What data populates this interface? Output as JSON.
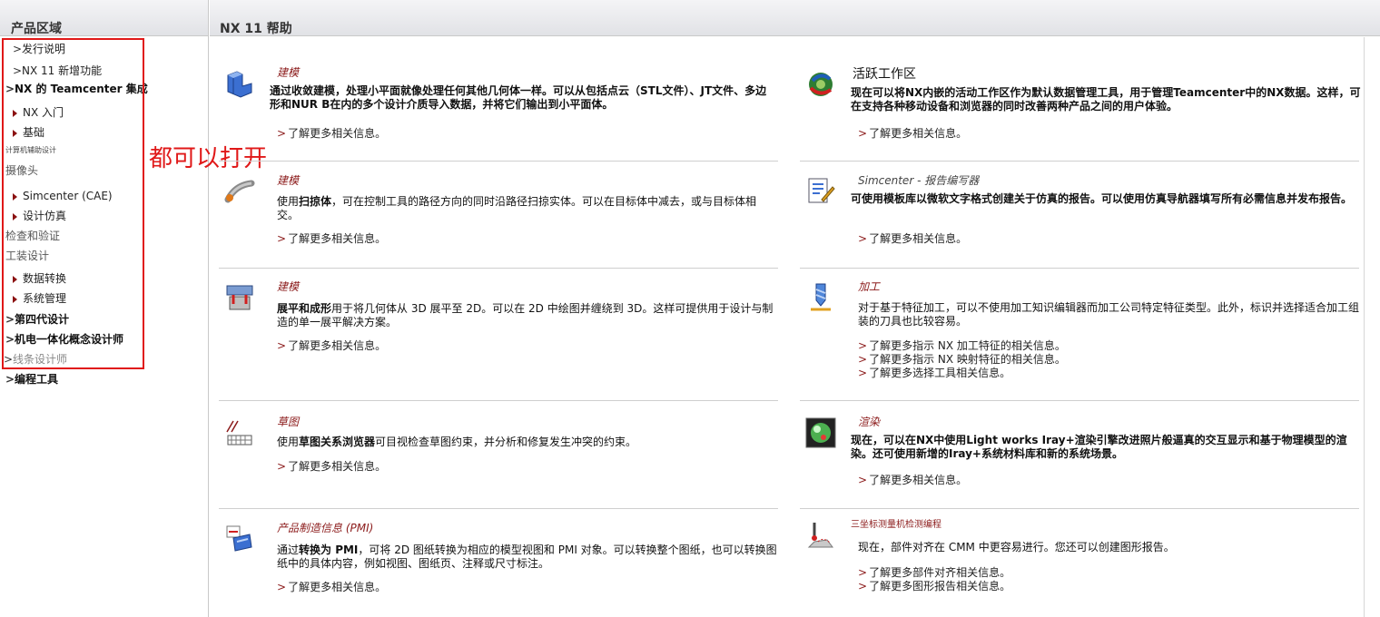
{
  "sidebar": {
    "header": "产品区域",
    "items": [
      {
        "label": "发行说明",
        "style": "lvl2",
        "marker": ">"
      },
      {
        "label": "NX 11 新增功能",
        "style": "lvl2",
        "marker": ">"
      },
      {
        "label": "NX 的 Teamcenter 集成",
        "style": "lvl1",
        "marker": ">"
      },
      {
        "label": "NX 入门",
        "style": "lvl2",
        "marker": "tri"
      },
      {
        "label": "基础",
        "style": "lvl2",
        "marker": "tri"
      },
      {
        "label": "计算机辅助设计",
        "style": "small",
        "marker": ""
      },
      {
        "label": "摄像头",
        "style": "cat",
        "marker": ""
      },
      {
        "label": "Simcenter (CAE)",
        "style": "lvl2",
        "marker": "tri"
      },
      {
        "label": "设计仿真",
        "style": "lvl2",
        "marker": "tri"
      },
      {
        "label": "检查和验证",
        "style": "cat",
        "marker": ""
      },
      {
        "label": "工装设计",
        "style": "cat",
        "marker": ""
      },
      {
        "label": "数据转换",
        "style": "lvl2",
        "marker": "tri"
      },
      {
        "label": "系统管理",
        "style": "lvl2",
        "marker": "tri"
      },
      {
        "label": "第四代设计",
        "style": "lvl1",
        "marker": ">"
      },
      {
        "label": "机电一体化概念设计师",
        "style": "lvl1",
        "marker": ">"
      },
      {
        "label": "线条设计师",
        "style": "muted",
        "marker": ">"
      },
      {
        "label": "编程工具",
        "style": "lvl1",
        "marker": ">"
      }
    ]
  },
  "annotation": "都可以打开",
  "main": {
    "header": "NX 11 帮助",
    "cards": [
      {
        "title": "建模",
        "icon": "modeling-block-icon",
        "desc": "通过收敛建模，处理小平面就像处理任何其他几何体一样。可以从包括点云（STL文件）、JT文件、多边形和NUR B在内的多个设计介质导入数据，并将它们输出到小平面体。",
        "desc_bold": true,
        "links": [
          "了解更多相关信息。"
        ]
      },
      {
        "title": "建模",
        "icon": "sweep-icon",
        "desc_parts": [
          "使用",
          "扫掠体",
          "，可在控制工具的路径方向的同时沿路径扫掠实体。可以在目标体中减去，或与目标体相交。"
        ],
        "links": [
          "了解更多相关信息。"
        ]
      },
      {
        "title": "建模",
        "icon": "flatten-form-icon",
        "desc_parts": [
          "",
          "展平和成形",
          "用于将几何体从 3D 展平至 2D。可以在 2D 中绘图并缠绕到 3D。这样可提供用于设计与制造的单一展平解决方案。"
        ],
        "links": [
          "了解更多相关信息。"
        ]
      },
      {
        "title": "草图",
        "icon": "sketch-icon",
        "desc_parts": [
          "使用",
          "草图关系浏览器",
          "可目视检查草图约束，并分析和修复发生冲突的约束。"
        ],
        "links": [
          "了解更多相关信息。"
        ]
      },
      {
        "title": "产品制造信息 (PMI)",
        "icon": "pmi-icon",
        "desc_parts": [
          "通过",
          "转换为 PMI",
          "，可将 2D 图纸转换为相应的模型视图和 PMI 对象。可以转换整个图纸，也可以转换图纸中的具体内容，例如视图、图纸页、注释或尺寸标注。"
        ],
        "links": [
          "了解更多相关信息。"
        ]
      },
      {
        "title": "活跃工作区",
        "icon": "active-workspace-icon",
        "desc": "现在可以将NX内嵌的活动工作区作为默认数据管理工具，用于管理Teamcenter中的NX数据。这样，可在支持各种移动设备和浏览器的同时改善两种产品之间的用户体验。",
        "desc_bold": true,
        "links": [
          "了解更多相关信息。"
        ]
      },
      {
        "title": "Simcenter - 报告编写器",
        "icon": "report-writer-icon",
        "desc": "可使用模板库以微软文字格式创建关于仿真的报告。可以使用仿真导航器填写所有必需信息并发布报告。",
        "desc_bold": true,
        "links": [
          "了解更多相关信息。"
        ]
      },
      {
        "title": "加工",
        "icon": "machining-tool-icon",
        "desc": "对于基于特征加工，可以不使用加工知识编辑器而加工公司特定特征类型。此外，标识并选择适合加工组装的刀具也比较容易。",
        "links": [
          "了解更多指示 NX 加工特征的相关信息。",
          "了解更多指示 NX 映射特征的相关信息。",
          "了解更多选择工具相关信息。"
        ]
      },
      {
        "title": "渲染",
        "icon": "render-sphere-icon",
        "desc": "现在，可以在NX中使用Light works Iray+渲染引擎改进照片般逼真的交互显示和基于物理模型的渲染。还可使用新增的Iray+系统材料库和新的系统场景。",
        "desc_bold": true,
        "links": [
          "了解更多相关信息。"
        ]
      },
      {
        "title": "三坐标测量机检测编程",
        "icon": "cmm-probe-icon",
        "desc": "现在，部件对齐在 CMM 中更容易进行。您还可以创建图形报告。",
        "links": [
          "了解更多部件对齐相关信息。",
          "了解更多图形报告相关信息。"
        ]
      }
    ],
    "link_marker": ">"
  }
}
